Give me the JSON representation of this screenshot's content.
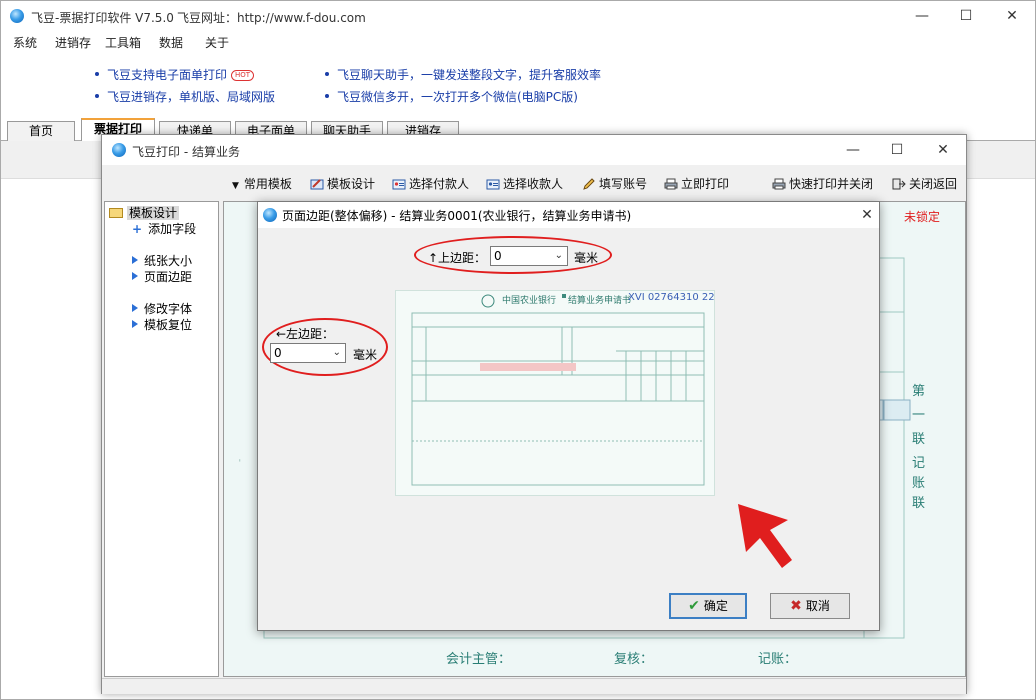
{
  "app": {
    "title": "飞豆-票据打印软件 V7.5.0",
    "website": "飞豆网址：http://www.f-dou.com"
  },
  "menu": [
    "系统",
    "进销存",
    "工具箱",
    "数据",
    "关于"
  ],
  "ads": {
    "left": [
      "飞豆支持电子面单打印",
      "飞豆进销存，单机版、局域网版"
    ],
    "right": [
      "飞豆聊天助手，一键发送整段文字，提升客服效率",
      "飞豆微信多开，一次打开多个微信(电脑PC版)"
    ],
    "hot_badge": "HOT"
  },
  "tabs": [
    "首页",
    "票据打印",
    "快递单",
    "电子面单",
    "聊天助手",
    "进销存"
  ],
  "settle_window": {
    "title": "飞豆打印 - 结算业务",
    "toolbar": [
      "常用模板",
      "模板设计",
      "选择付款人",
      "选择收款人",
      "填写账号",
      "立即打印",
      "快速打印并关闭",
      "关闭返回"
    ],
    "tree": {
      "root": "模板设计",
      "add_field": "添加字段",
      "items": [
        "纸张大小",
        "页面边距",
        "修改字体",
        "模板复位"
      ]
    },
    "lock_status": "未锁定",
    "bill_footer": [
      "会计主管：",
      "复核：",
      "记账："
    ],
    "bill_side": [
      "第",
      "一",
      "联",
      "记",
      "账",
      "联"
    ]
  },
  "dialog": {
    "title": "页面边距(整体偏移) - 结算业务0001(农业银行，结算业务申请书)",
    "top_label": "↑上边距：",
    "top_value": "0",
    "left_label": "←左边距：",
    "left_value": "0",
    "unit": "毫米",
    "preview": {
      "bank": "中国农业银行",
      "form_title": "结算业务申请书",
      "serial": "XVI 02764310 22"
    },
    "ok_label": "确定",
    "cancel_label": "取消"
  },
  "colors": {
    "accent_red": "#e01e1e",
    "link_blue": "#1a3ea8",
    "tab_orange": "#f2a23a"
  }
}
